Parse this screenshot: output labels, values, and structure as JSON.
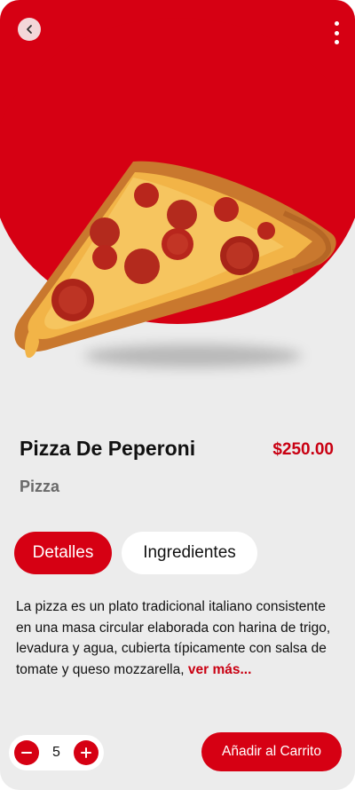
{
  "product": {
    "name": "Pizza De Peperoni",
    "price": "$250.00",
    "category": "Pizza"
  },
  "tabs": [
    {
      "label": "Detalles",
      "active": true
    },
    {
      "label": "Ingredientes",
      "active": false
    }
  ],
  "description": {
    "text": "La pizza es un plato tradicional italiano consistente en una masa  circular elaborada con harina de trigo, levadura y agua, cubierta típicamente con salsa de tomate y queso mozzarella,",
    "more_label": "ver más..."
  },
  "quantity": {
    "value": "5"
  },
  "cart_button": {
    "label": "Añadir al Carrito"
  },
  "colors": {
    "accent": "#d60013",
    "background": "#ececec"
  },
  "icons": {
    "back": "chevron-left-icon",
    "menu": "more-vertical-icon",
    "minus": "minus-icon",
    "plus": "plus-icon"
  }
}
